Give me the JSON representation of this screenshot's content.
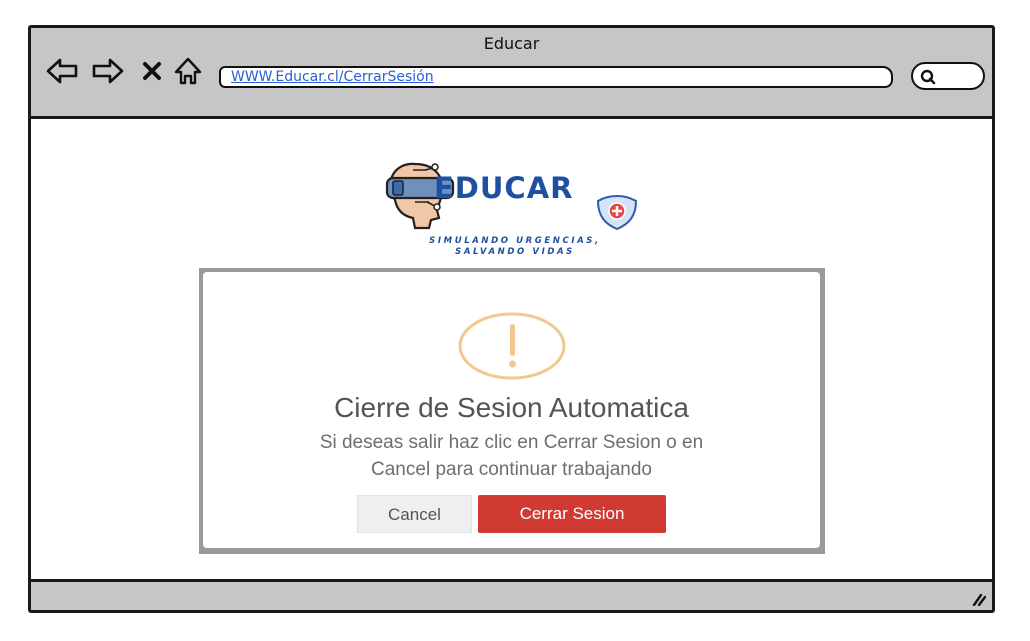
{
  "window": {
    "title": "Educar"
  },
  "nav": {
    "back_icon": "arrow-left-icon",
    "forward_icon": "arrow-right-icon",
    "stop_icon": "close-icon",
    "home_icon": "home-icon"
  },
  "address_bar": {
    "url": "WWW.Educar.cl/CerrarSesión"
  },
  "search": {
    "icon": "search-icon"
  },
  "logo": {
    "brand": "EDUCAR",
    "tagline_line1": "SIMULANDO URGENCIAS,",
    "tagline_line2": "SALVANDO VIDAS"
  },
  "dialog": {
    "icon": "warning-icon",
    "title": "Cierre de Sesion Automatica",
    "message_line1": "Si deseas salir haz clic en Cerrar Sesion o en",
    "message_line2": "Cancel para continuar trabajando",
    "cancel_label": "Cancel",
    "confirm_label": "Cerrar Sesion"
  },
  "colors": {
    "brand_blue": "#1f4fa0",
    "warning_orange": "#f1c88f",
    "danger_red": "#d03a33"
  }
}
